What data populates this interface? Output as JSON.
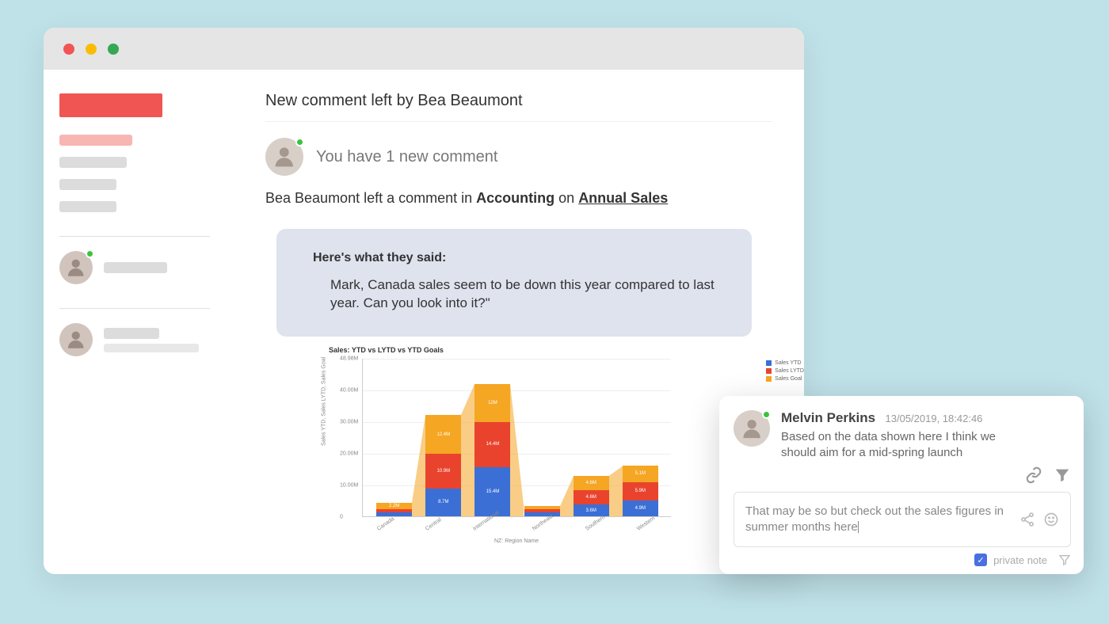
{
  "header": {
    "title": "New comment left by Bea Beaumont"
  },
  "notification": {
    "text": "You have 1 new comment",
    "prefix": "Bea Beaumont left a comment in ",
    "workspace": "Accounting",
    "joiner": " on ",
    "dashboard": "Annual Sales"
  },
  "comment": {
    "label": "Here's what they said:",
    "body": "Mark, Canada sales seem to be down this year compared to last year. Can you look into it?\""
  },
  "chart_data": {
    "type": "bar",
    "title": "Sales: YTD vs LYTD vs YTD Goals",
    "xlabel": "NZ: Region Name",
    "ylabel": "Sales YTD, Sales LYTD, Sales Goal",
    "ylim": [
      0,
      50
    ],
    "yticks": [
      "0",
      "10.00M",
      "20.00M",
      "30.00M",
      "40.00M",
      "48.98M"
    ],
    "categories": [
      "Canada",
      "Central",
      "International",
      "Northeast",
      "Southern",
      "Western"
    ],
    "series": [
      {
        "name": "Sales YTD",
        "color": "#3b6fd6",
        "values": [
          1.1,
          8.7,
          15.4,
          1.2,
          3.6,
          4.9
        ]
      },
      {
        "name": "Sales LYTD",
        "color": "#e9432e",
        "values": [
          1.0,
          10.9,
          14.4,
          0.9,
          4.6,
          5.9
        ]
      },
      {
        "name": "Sales Goal",
        "color": "#f5a623",
        "values": [
          2.2,
          12.4,
          12.0,
          1.1,
          4.6,
          5.1
        ]
      }
    ],
    "labels": [
      [
        "",
        "",
        "2.2M"
      ],
      [
        "8.7M",
        "10.9M",
        "12.4M"
      ],
      [
        "15.4M",
        "14.4M",
        "12M"
      ],
      [
        "",
        "",
        ""
      ],
      [
        "3.6M",
        "4.6M",
        "4.6M"
      ],
      [
        "4.9M",
        "5.9M",
        "5.1M"
      ]
    ]
  },
  "popup": {
    "name": "Melvin Perkins",
    "timestamp": "13/05/2019, 18:42:46",
    "message": "Based on the data shown here I think we should aim for a mid-spring launch",
    "reply": "That may be so but check out the sales figures in summer months here",
    "private_note": "private note"
  }
}
